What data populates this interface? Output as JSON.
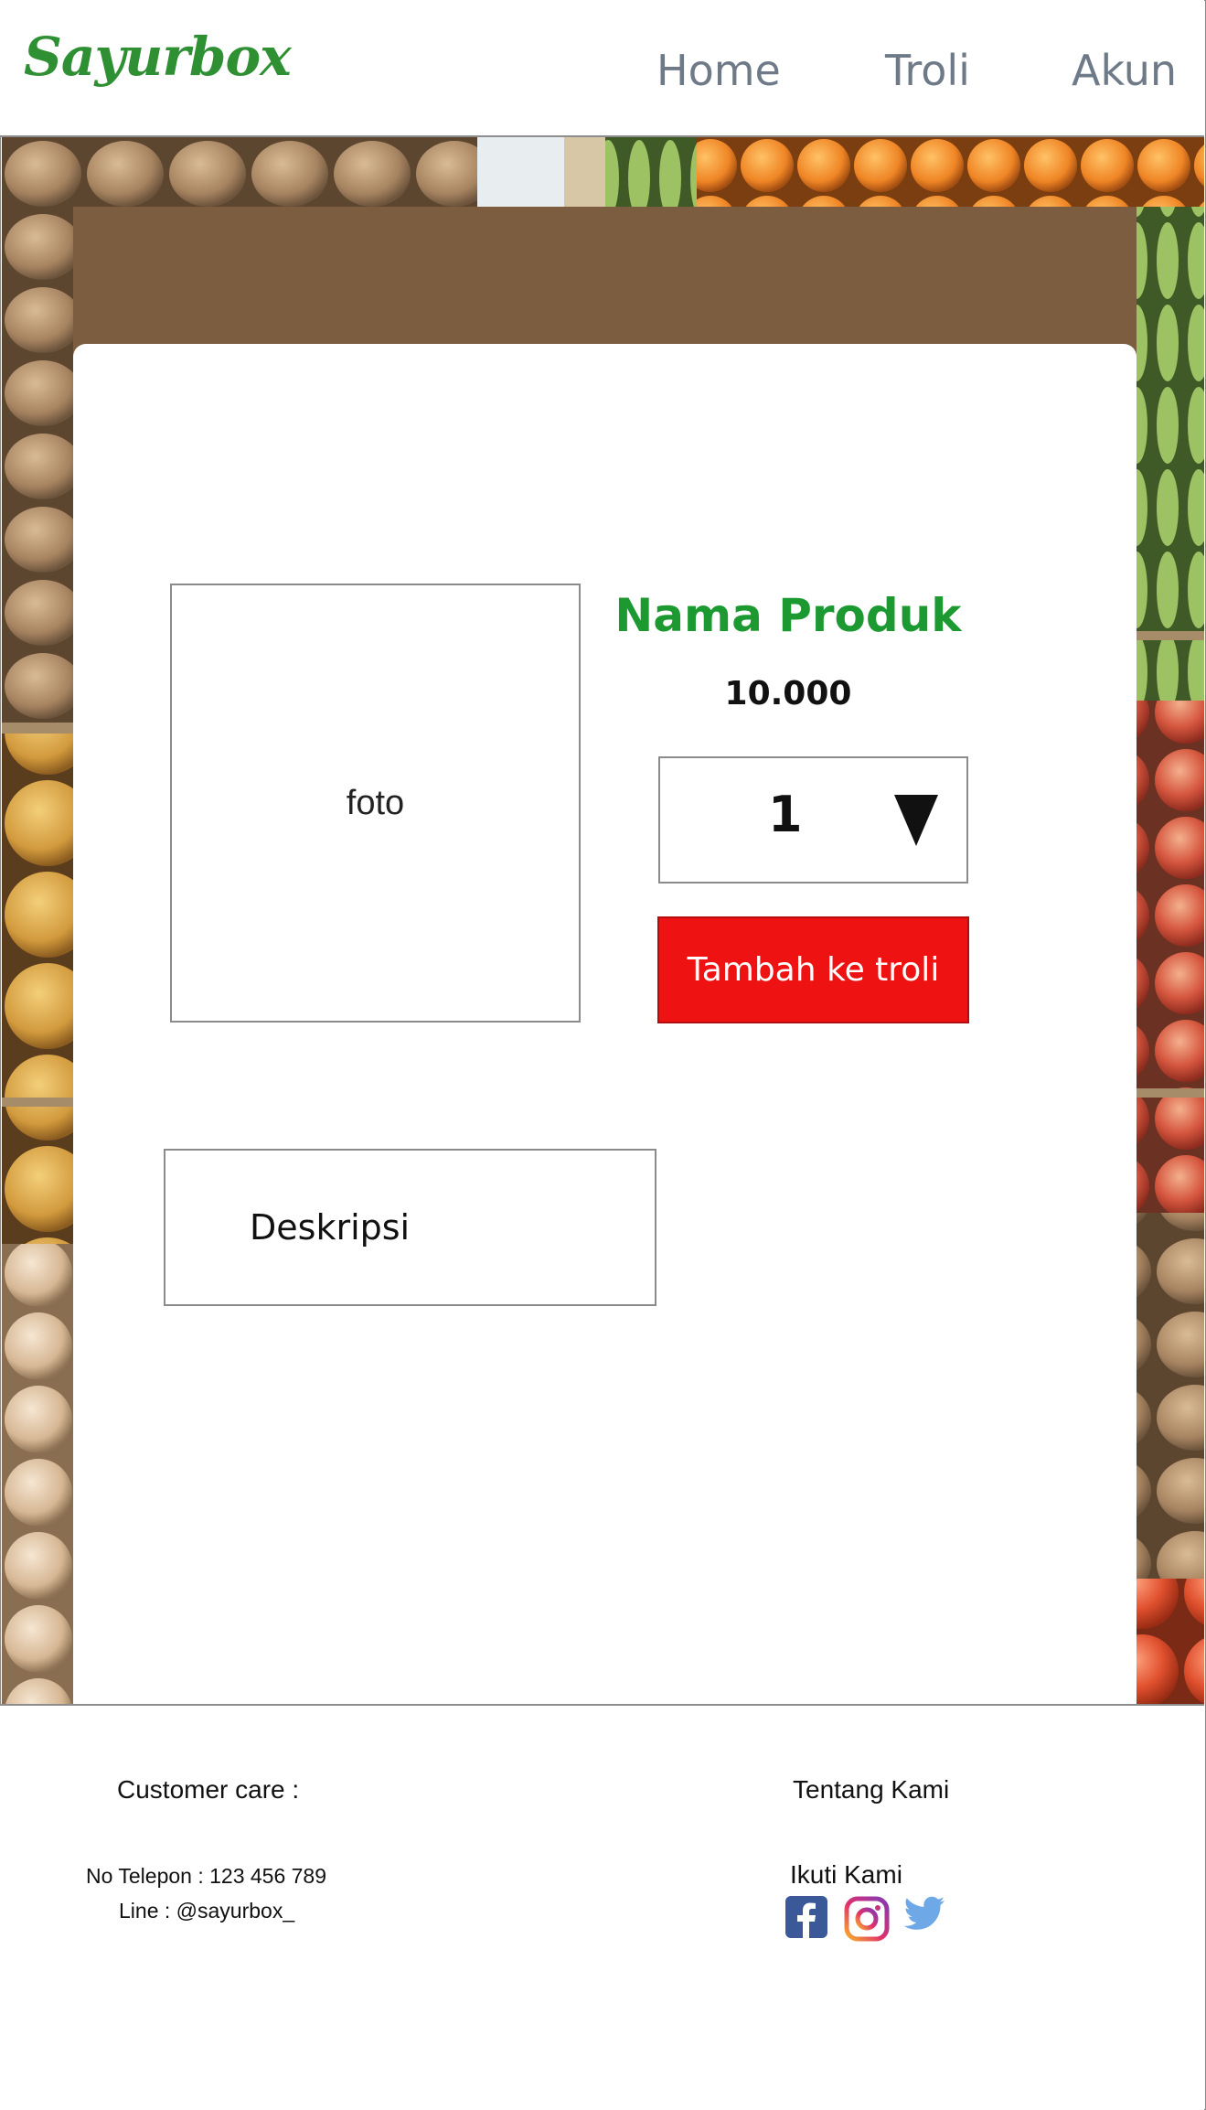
{
  "header": {
    "logo": "Sayurbox",
    "nav": [
      {
        "label": "Home"
      },
      {
        "label": "Troli"
      },
      {
        "label": "Akun"
      }
    ]
  },
  "product": {
    "photo_placeholder": "foto",
    "name": "Nama Produk",
    "price": "10.000",
    "quantity": "1",
    "add_to_cart_label": "Tambah ke troli",
    "description_label": "Deskripsi"
  },
  "footer": {
    "customer_care_title": "Customer care :",
    "phone": "No Telepon : 123 456 789",
    "line": "Line : @sayurbox_",
    "about_label": "Tentang Kami",
    "follow_label": "Ikuti Kami",
    "social": [
      "facebook-icon",
      "instagram-icon",
      "twitter-icon"
    ]
  },
  "colors": {
    "brand_green": "#2f8f33",
    "product_name_green": "#1c9a31",
    "cta_red": "#ee1212",
    "nav_gray": "#6f7a88"
  }
}
